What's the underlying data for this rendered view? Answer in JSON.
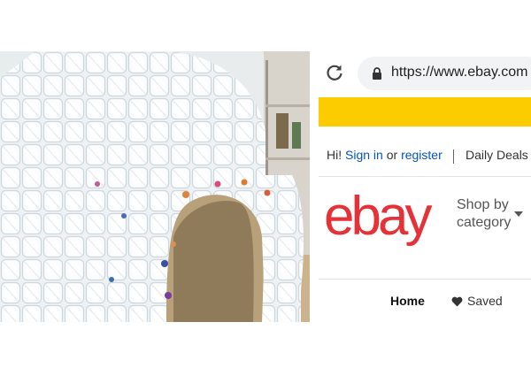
{
  "photo": {
    "subject": "igloo made of plastic milk jugs"
  },
  "browser": {
    "url": "https://www.ebay.com",
    "reload_icon": "reload-icon",
    "lock_icon": "lock-icon"
  },
  "header": {
    "greeting_prefix": "Hi!",
    "sign_in": "Sign in",
    "or": "or",
    "register": "register",
    "daily_deals": "Daily Deals"
  },
  "brand": {
    "logo_letters": [
      "e",
      "b",
      "a",
      "y"
    ],
    "colors": [
      "#e53238",
      "#0064d2",
      "#f5af02",
      "#86b817"
    ],
    "accent_band": "#fccc00"
  },
  "category": {
    "line1": "Shop by",
    "line2": "category",
    "icon": "chevron-down-icon"
  },
  "nav": {
    "home": "Home",
    "saved": "Saved",
    "saved_icon": "heart-icon"
  }
}
